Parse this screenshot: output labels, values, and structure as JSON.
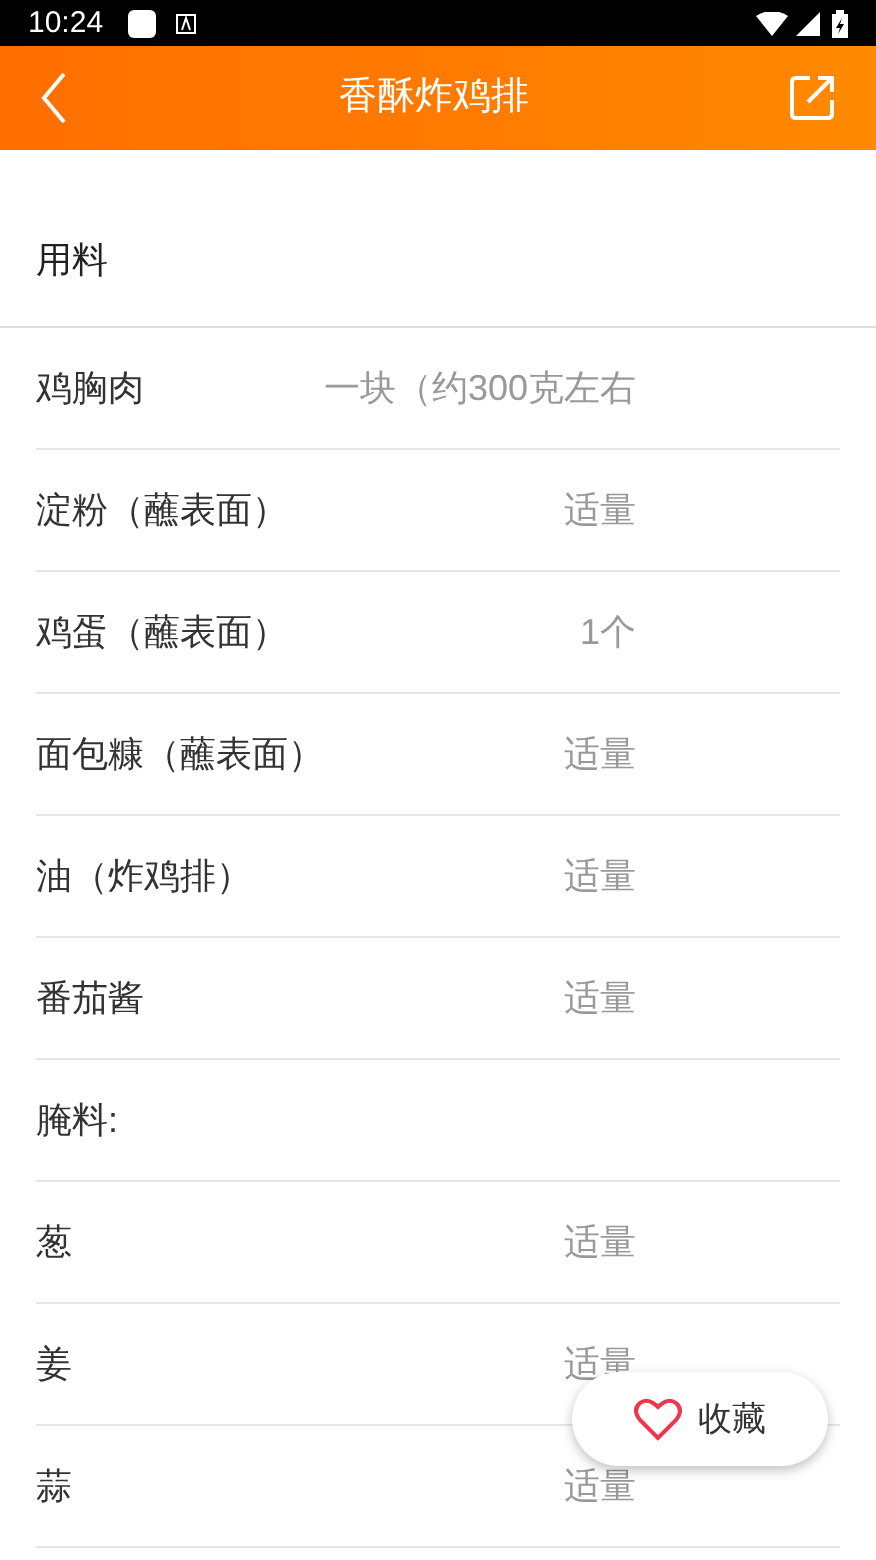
{
  "status_bar": {
    "time": "10:24"
  },
  "header": {
    "title": "香酥炸鸡排"
  },
  "section": {
    "title": "用料"
  },
  "ingredients": [
    {
      "name": "鸡胸肉",
      "amount": "一块（约300克左右"
    },
    {
      "name": "淀粉（蘸表面）",
      "amount": "适量"
    },
    {
      "name": "鸡蛋（蘸表面）",
      "amount": "1个"
    },
    {
      "name": "面包糠（蘸表面）",
      "amount": "适量"
    },
    {
      "name": "油（炸鸡排）",
      "amount": "适量"
    },
    {
      "name": "番茄酱",
      "amount": "适量"
    },
    {
      "name": "腌料:"
    },
    {
      "name": "葱",
      "amount": "适量"
    },
    {
      "name": "姜",
      "amount": "适量"
    },
    {
      "name": "蒜",
      "amount": "适量"
    }
  ],
  "favorite_button": {
    "label": "收藏",
    "selected": false
  }
}
